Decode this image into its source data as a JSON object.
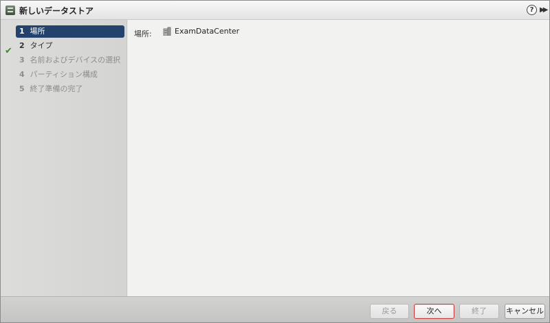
{
  "window": {
    "title": "新しいデータストア",
    "icon": "datastore-icon",
    "help_icon": "?",
    "expand_icon": "▶▶"
  },
  "steps": [
    {
      "number": "1",
      "label": "場所",
      "state": "active",
      "completed": true
    },
    {
      "number": "2",
      "label": "タイプ",
      "state": "enabled",
      "completed": false
    },
    {
      "number": "3",
      "label": "名前およびデバイスの選択",
      "state": "disabled",
      "completed": false
    },
    {
      "number": "4",
      "label": "パーティション構成",
      "state": "disabled",
      "completed": false
    },
    {
      "number": "5",
      "label": "終了準備の完了",
      "state": "disabled",
      "completed": false
    }
  ],
  "content": {
    "location_label": "場所:",
    "location_value": "ExamDataCenter",
    "location_icon": "datacenter-icon"
  },
  "footer": {
    "back_label": "戻る",
    "next_label": "次へ",
    "finish_label": "終了",
    "cancel_label": "キャンセル"
  },
  "colors": {
    "active_step_bg": "#23436d",
    "check_color": "#3a8a2a",
    "primary_border": "#c83a3a"
  }
}
